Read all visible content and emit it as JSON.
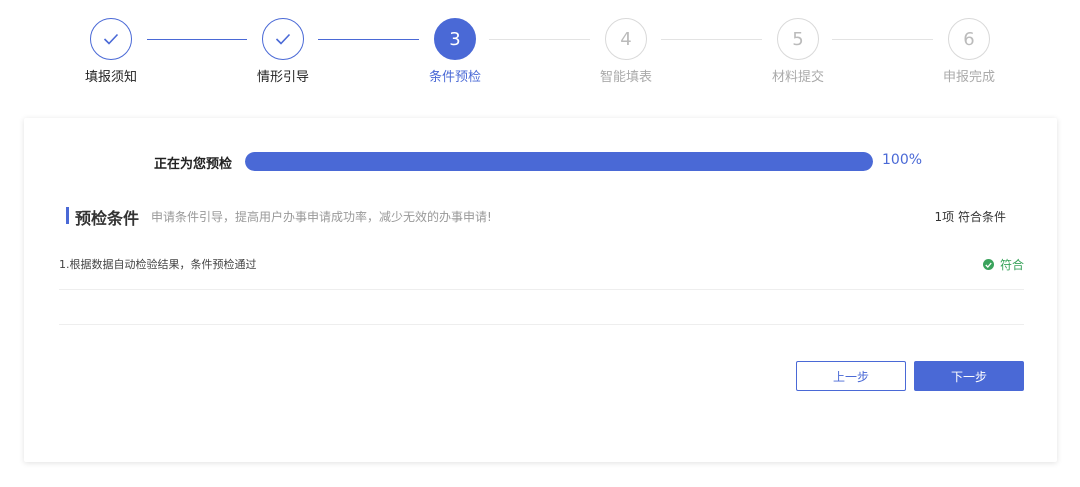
{
  "steps": [
    {
      "num": "",
      "label": "填报须知",
      "state": "done"
    },
    {
      "num": "",
      "label": "情形引导",
      "state": "done"
    },
    {
      "num": "3",
      "label": "条件预检",
      "state": "current"
    },
    {
      "num": "4",
      "label": "智能填表",
      "state": "pending"
    },
    {
      "num": "5",
      "label": "材料提交",
      "state": "pending"
    },
    {
      "num": "6",
      "label": "申报完成",
      "state": "pending"
    }
  ],
  "progress": {
    "label": "正在为您预检",
    "value": 100,
    "text": "100%"
  },
  "section": {
    "title": "预检条件",
    "description": "申请条件引导，提高用户办事申请成功率，减少无效的办事申请!",
    "count": "1项 符合条件"
  },
  "conditions": [
    {
      "text": "1.根据数据自动检验结果，条件预检通过",
      "status": "符合"
    }
  ],
  "buttons": {
    "prev": "上一步",
    "next": "下一步"
  },
  "colors": {
    "accent": "#4a69d6",
    "success": "#3aa35c",
    "pending": "#d9d9d9"
  },
  "icons": {
    "done_step": "check-icon",
    "status_pass": "check-circle-icon"
  }
}
